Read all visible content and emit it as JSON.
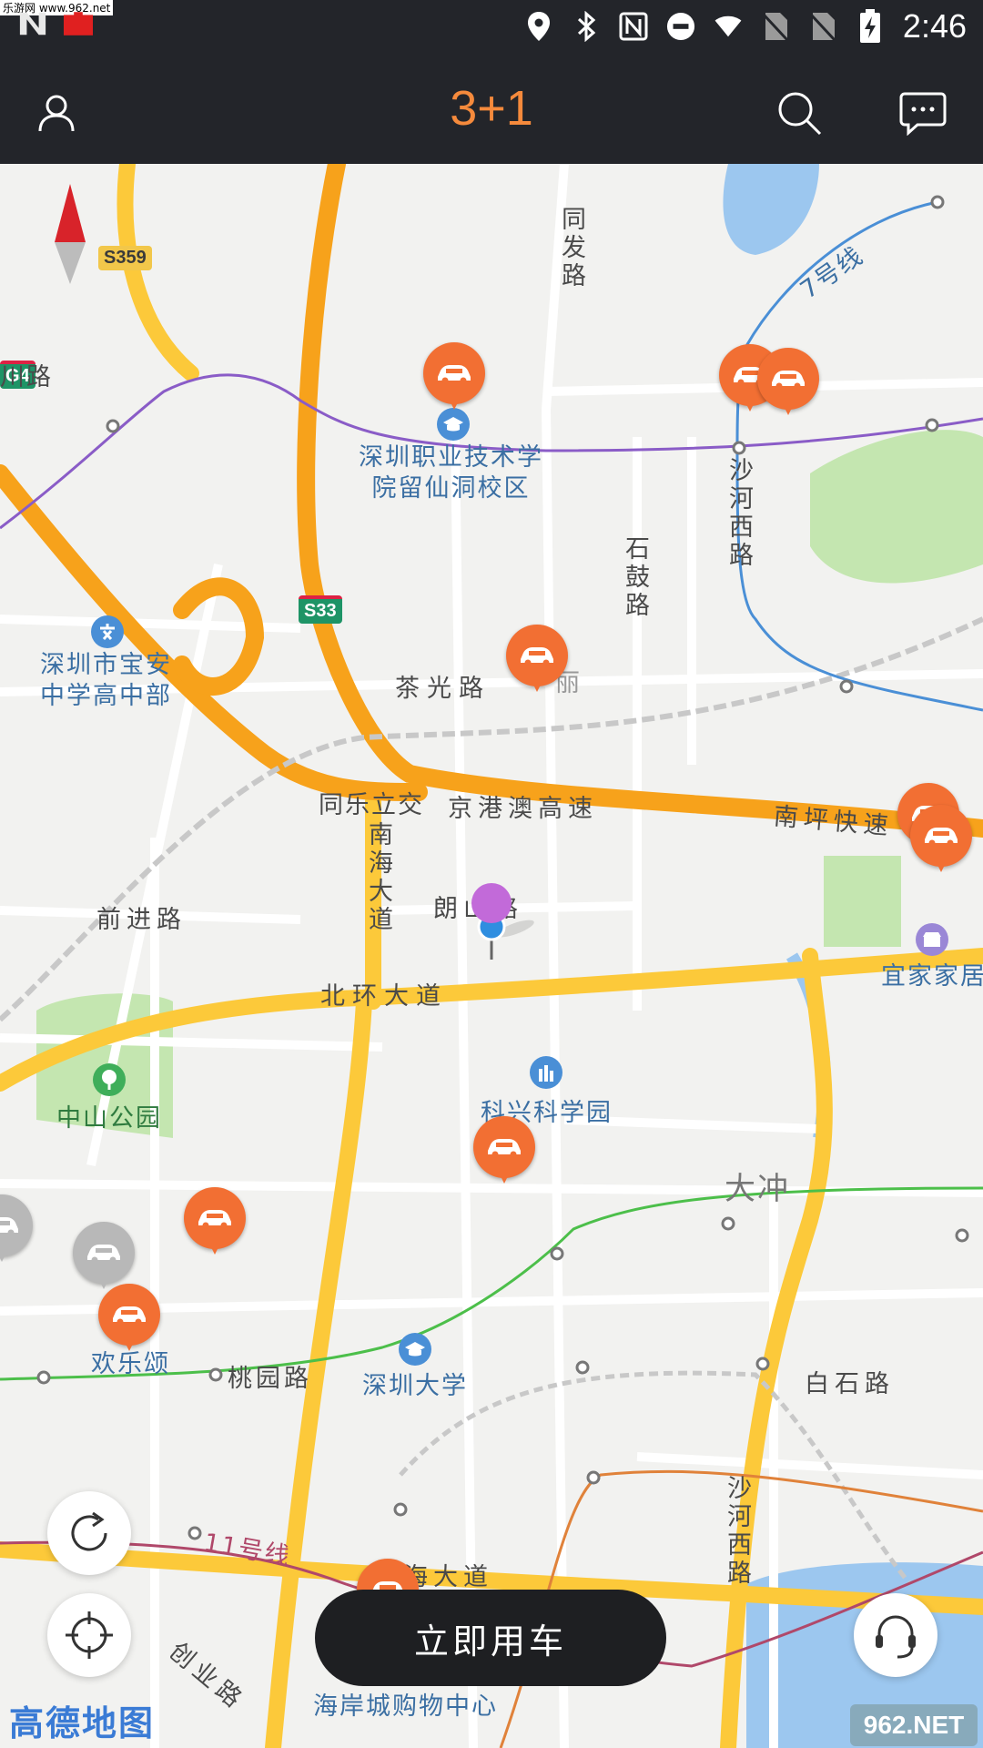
{
  "status_bar": {
    "time": "2:46",
    "watermark": "乐游网 www.962.net",
    "icons": [
      "n-logo-icon",
      "red-app-icon",
      "location-icon",
      "bluetooth-icon",
      "nfc-icon",
      "do-not-disturb-icon",
      "wifi-icon",
      "no-sim-icon",
      "no-sim-icon",
      "battery-charging-icon"
    ]
  },
  "header": {
    "title": "3+1",
    "left_icon": "user-icon",
    "right_icons": [
      "search-icon",
      "message-icon"
    ]
  },
  "map": {
    "labels": {
      "tongfa_road": "同发路",
      "line7": "7号线",
      "s359": "S359",
      "chuan_road": "川路",
      "g4": "G4",
      "shenzhen_polytechnic": "深圳职业技术学\n院留仙洞校区",
      "shahe_west_road_top": "沙河西路",
      "shigu_road": "石鼓路",
      "s33": "S33",
      "baoan_middle_school": "深圳市宝安\n中学高中部",
      "chaguang_road": "茶光路",
      "li": "丽",
      "tongle_interchange": "同乐立交",
      "jingang_expressway": "京港澳高速",
      "nanping_expressway": "南坪快速",
      "nanhai_avenue_top": "南海大道",
      "qianjin_road": "前进路",
      "langshan_road": "朗山路",
      "yijia_home": "宜家家居",
      "beihuan_avenue": "北环大道",
      "zhongshan_park": "中山公园",
      "kexing_park": "科兴科学园",
      "dachong": "大冲",
      "huanlesong": "欢乐颂",
      "taoyuan_road": "桃园路",
      "shenzhen_university": "深圳大学",
      "baishi_road": "白石路",
      "line11": "11号线",
      "shahe_west_road_bottom": "沙河西路",
      "nanhai_avenue_bottom": "南海大道",
      "chuangye_road": "创业路",
      "coastal_city": "海岸城购物中心"
    },
    "colors": {
      "background": "#f2f2f0",
      "expressway": "#f7a21b",
      "main_road": "#fcc93a",
      "water": "#9cc7ef",
      "green_area": "#c4e6b0",
      "car_marker": "#f26f33",
      "line7": "#4a8fd6",
      "purple_line": "#8a5cc7",
      "green_line": "#4cbf4a",
      "line11": "#b0486a",
      "orange_line": "#e0823a"
    },
    "logo": "高德地图"
  },
  "actions": {
    "use_car_now": "立即用车",
    "site_badge": "962.NET"
  }
}
